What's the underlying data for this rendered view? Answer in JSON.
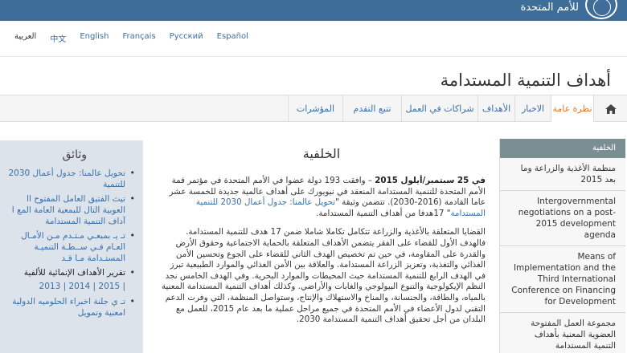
{
  "header": {
    "org_text": "للأمم المتحدة"
  },
  "languages": [
    {
      "label": "العربية",
      "current": true
    },
    {
      "label": "中文"
    },
    {
      "label": "English"
    },
    {
      "label": "Français"
    },
    {
      "label": "Русский"
    },
    {
      "label": "Español"
    }
  ],
  "page_title": "أهداف التنمية المستدامة",
  "nav": {
    "home_icon": "home-icon",
    "tabs": [
      {
        "label": "نظرة عامة",
        "active": true
      },
      {
        "label": "الاخبار"
      },
      {
        "label": "الأهداف"
      },
      {
        "label": "شراكات في العمل"
      },
      {
        "label": "تتبع التقدم"
      },
      {
        "label": "المؤشرات"
      }
    ]
  },
  "documents": {
    "title": "وثائق",
    "items": [
      "تحويل عالمنا: جدول أعمال 2030 للتنمية",
      "تيث الفتيق العامل المفتوح اا العوبية التال للبمعية العامة المع ا آداف التنمية المستدامة",
      "تـ يـ بمبعـي مـتـدم مـن الأمـال العـام فـي ســطـة التنميـة المستـدامة مـا قـد",
      "تقرير الأهداف الإنمائية للألفية"
    ],
    "years": "2013 | 2014 | 2015 |",
    "last_item": "تـ ي جلنة اخبراء الحلوميه الدولية امعنية وتمويل"
  },
  "content": {
    "heading": "الخلفية",
    "p1_bold": "في 25 سبتمبر/أيلول 2015",
    "p1_text": " – وافقت 193 دولة عضوا في الأمم المتحدة في مؤتمر قمة الأمم المتحدة للتنمية المستدامة المنعقد في نيويورك على أهداف عالمية جديدة للخمسة عشر عاما القادمة (2016-2030). تتضمن وثيقة \"",
    "p1_link": "تحويل عالمنا: جدول أعمال 2030 للتنمية المستدامة",
    "p1_tail": "\" 17هدفا من أهداف التنمية المستدامة.",
    "p2": "القضايا المتعلقة بالأغذية والزراعة تتكامل تكاملا شاملا ضمن 17 هدف للتنمية المستدامة. فالهدف الأول للقضاء على الفقر يتضمن الأهداف المتعلقة بالحماية الاجتماعية وحقوق الأرض والقدرة على المقاومة، في حين تم تخصيص الهدف الثاني للقضاء على الجوع وتحسين الأمن الغذائي والتغذية، وتعزيز الزراعة المستدامة. والعلاقة بين الأمن الغذائي والموارد الطبيعية تبرز في الهدف الرابع للتنمية المستدامة حيث المحيطات والموارد البحرية. وفي الهدف الخامس نجد النظم الإيكولوجية والتنوع البيولوجي والغابات والأراضي. وكذلك أهداف التنمية المستدامة المعنية بالمياه، والطاقة، والجنسانة، والمناخ والاستهلاك والإنتاج، وستواصل المنظمة، التي وفرت الدعم التقني لدول الأعضاء في الأمم المتحدة في جميع مراحل عملية ما بعد عام 2015، للعمل مع البلدان من أجل تحقيق أهداف التنمية المستدامة 2030."
  },
  "sidebar": {
    "header": "الخلفية",
    "items": [
      {
        "label": "منظمة الأغذية والزراعة وما بعد 2015",
        "dir": "rtl"
      },
      {
        "label": "Intergovernmental negotiations on a post-2015 development agenda",
        "dir": "ltr"
      },
      {
        "label": "Means of Implementation and the Third International Conference on Financing for Development",
        "dir": "ltr"
      },
      {
        "label": "مجموعة العمل المفتوحة العضوية المعنية بأهداف التنمية المستدامة",
        "dir": "rtl"
      }
    ]
  }
}
